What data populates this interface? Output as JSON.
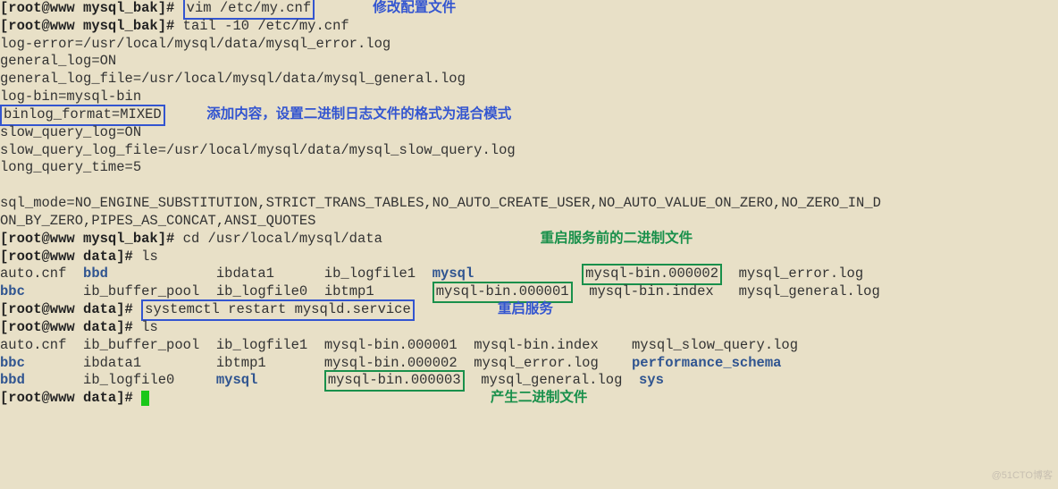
{
  "prompt1": "[root@www mysql_bak]# ",
  "promptData": "[root@www data]# ",
  "cmd": {
    "vim": "vim /etc/my.cnf",
    "tail": "tail -10 /etc/my.cnf",
    "cd": "cd /usr/local/mysql/data",
    "ls": "ls",
    "restart": "systemctl restart mysqld.service"
  },
  "annot": {
    "editConf": "修改配置文件",
    "addMixed": "添加内容，设置二进制日志文件的格式为混合模式",
    "beforeBin": "重启服务前的二进制文件",
    "restartSvc": "重启服务",
    "genBin": "产生二进制文件"
  },
  "cnf": {
    "l1": "log-error=/usr/local/mysql/data/mysql_error.log",
    "l2": "general_log=ON",
    "l3": "general_log_file=/usr/local/mysql/data/mysql_general.log",
    "l4": "log-bin=mysql-bin",
    "l5": "binlog_format=MIXED",
    "l6": "slow_query_log=ON",
    "l7": "slow_query_log_file=/usr/local/mysql/data/mysql_slow_query.log",
    "l8": "long_query_time=5",
    "l9": "sql_mode=NO_ENGINE_SUBSTITUTION,STRICT_TRANS_TABLES,NO_AUTO_CREATE_USER,NO_AUTO_VALUE_ON_ZERO,NO_ZERO_IN_D",
    "l10": "ON_BY_ZERO,PIPES_AS_CONCAT,ANSI_QUOTES"
  },
  "ls1": {
    "c1": [
      "auto.cnf",
      "bbc"
    ],
    "c2": [
      "bbd",
      "ib_buffer_pool"
    ],
    "c3": [
      "ibdata1",
      "ib_logfile0"
    ],
    "c4": [
      "ib_logfile1",
      "ibtmp1"
    ],
    "c5": [
      "mysql",
      "mysql-bin.000001"
    ],
    "c6": [
      "mysql-bin.000002",
      "mysql-bin.index"
    ],
    "c7": [
      "mysql_error.log",
      "mysql_general.log"
    ]
  },
  "ls2": {
    "c1": [
      "auto.cnf",
      "bbc",
      "bbd"
    ],
    "c2": [
      "ib_buffer_pool",
      "ibdata1",
      "ib_logfile0"
    ],
    "c3": [
      "ib_logfile1",
      "ibtmp1",
      "mysql"
    ],
    "c4": [
      "mysql-bin.000001",
      "mysql-bin.000002",
      "mysql-bin.000003"
    ],
    "c5": [
      "mysql-bin.index",
      "mysql_error.log",
      "mysql_general.log"
    ],
    "c6": [
      "mysql_slow_query.log",
      "performance_schema",
      "sys"
    ]
  },
  "watermark": "@51CTO博客"
}
